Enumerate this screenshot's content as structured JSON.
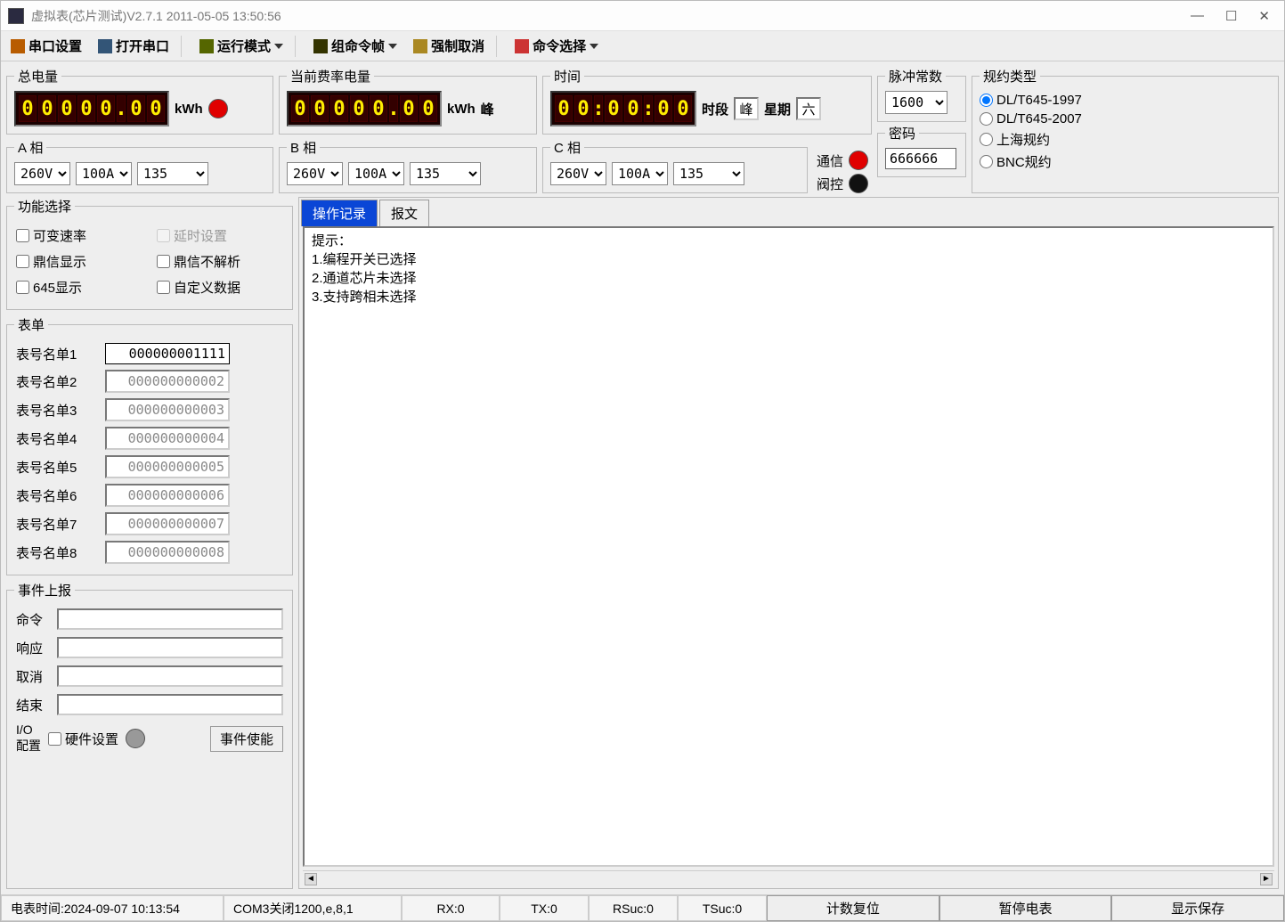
{
  "window": {
    "title": "虚拟表(芯片测试)V2.7.1 2011-05-05 13:50:56"
  },
  "toolbar": {
    "port_settings": "串口设置",
    "open_port": "打开串口",
    "run_mode": "运行模式",
    "group_cmd": "组命令帧",
    "force_cancel": "强制取消",
    "cmd_select": "命令选择"
  },
  "displays": {
    "total_energy": {
      "title": "总电量",
      "digits": "00000.00",
      "unit": "kWh"
    },
    "current_rate": {
      "title": "当前费率电量",
      "digits": "00000.00",
      "unit": "kWh",
      "suffix": "峰"
    },
    "time": {
      "title": "时间",
      "digits": "00:00:00",
      "period_label": "时段",
      "period_value": "峰",
      "week_label": "星期",
      "week_value": "六"
    }
  },
  "phases": {
    "a": {
      "title": "A 相",
      "voltage": "260V",
      "current": "100A",
      "other": "135"
    },
    "b": {
      "title": "B 相",
      "voltage": "260V",
      "current": "100A",
      "other": "135"
    },
    "c": {
      "title": "C 相",
      "voltage": "260V",
      "current": "100A",
      "other": "135"
    }
  },
  "indicators": {
    "comm_label": "通信",
    "valve_label": "阀控"
  },
  "pulse": {
    "title": "脉冲常数",
    "value": "1600"
  },
  "password": {
    "title": "密码",
    "value": "666666"
  },
  "protocol": {
    "title": "规约类型",
    "options": [
      "DL/T645-1997",
      "DL/T645-2007",
      "上海规约",
      "BNC规约"
    ],
    "selected": 0
  },
  "func": {
    "title": "功能选择",
    "items": [
      "可变速率",
      "延时设置",
      "鼎信显示",
      "鼎信不解析",
      "645显示",
      "自定义数据"
    ]
  },
  "meters": {
    "title": "表单",
    "rows": [
      {
        "label": "表号名单1",
        "value": "000000001111",
        "active": true
      },
      {
        "label": "表号名单2",
        "value": "000000000002",
        "active": false
      },
      {
        "label": "表号名单3",
        "value": "000000000003",
        "active": false
      },
      {
        "label": "表号名单4",
        "value": "000000000004",
        "active": false
      },
      {
        "label": "表号名单5",
        "value": "000000000005",
        "active": false
      },
      {
        "label": "表号名单6",
        "value": "000000000006",
        "active": false
      },
      {
        "label": "表号名单7",
        "value": "000000000007",
        "active": false
      },
      {
        "label": "表号名单8",
        "value": "000000000008",
        "active": false
      }
    ]
  },
  "events": {
    "title": "事件上报",
    "cmd_label": "命令",
    "resp_label": "响应",
    "cancel_label": "取消",
    "end_label": "结束",
    "io_label": "I/O\n配置",
    "hw_label": "硬件设置",
    "enable_btn": "事件使能"
  },
  "log": {
    "tab_record": "操作记录",
    "tab_message": "报文",
    "content": "提示：\n1.编程开关已选择\n2.通道芯片未选择\n3.支持跨相未选择"
  },
  "status": {
    "meter_time": "电表时间:2024-09-07 10:13:54",
    "com": "COM3关闭1200,e,8,1",
    "rx": "RX:0",
    "tx": "TX:0",
    "rsuc": "RSuc:0",
    "tsuc": "TSuc:0",
    "btn_reset": "计数复位",
    "btn_pause": "暂停电表",
    "btn_save": "显示保存"
  }
}
